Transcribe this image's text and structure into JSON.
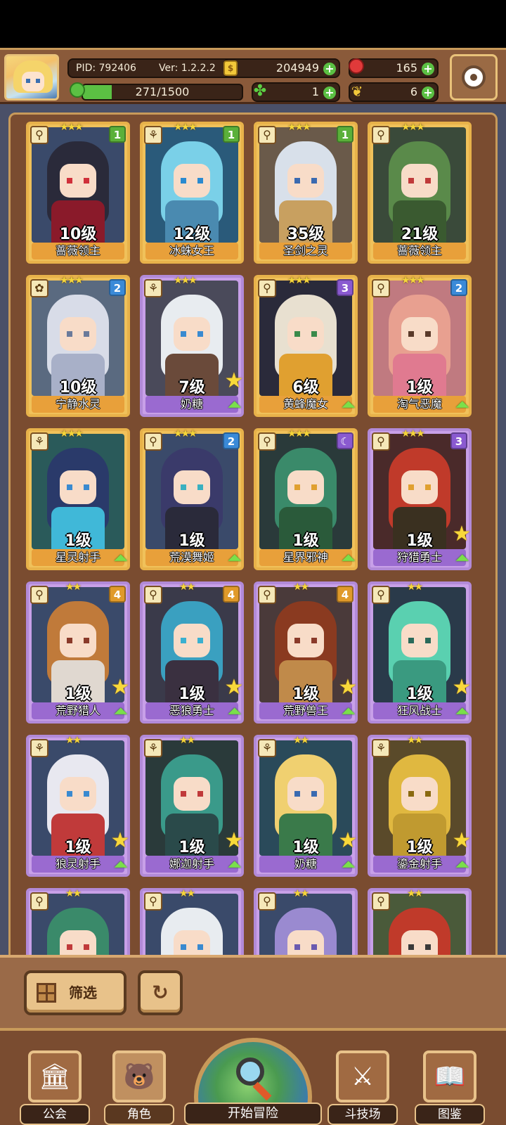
{
  "header": {
    "pid": "PID: 792406",
    "version": "Ver: 1.2.2.2",
    "gold": "204949",
    "gems": "165",
    "energy": "271/1500",
    "energy_fraction": 0.18,
    "clover": "1",
    "tickets": "6",
    "gold_symbol": "$",
    "clover_symbol": "✤",
    "ticket_symbol": "❦"
  },
  "icons": {
    "plus": "+",
    "star3": "★★★",
    "star2": "★★",
    "upgrade": "⏶",
    "bigstar": "★",
    "reset": "↻",
    "guild": "🏛",
    "character": "🐻",
    "arena": "⚔",
    "codex": "📖"
  },
  "cards": [
    {
      "level": "10级",
      "name": "蔷薇领主",
      "badge": "1",
      "badge_color": "green",
      "rarity": "gold",
      "stars": 3,
      "class_icon": "⚲"
    },
    {
      "level": "12级",
      "name": "冰蛛女王",
      "badge": "1",
      "badge_color": "green",
      "rarity": "gold",
      "stars": 3,
      "class_icon": "⚘"
    },
    {
      "level": "35级",
      "name": "圣剑之灵",
      "badge": "1",
      "badge_color": "green",
      "rarity": "gold",
      "stars": 3,
      "class_icon": "⚲"
    },
    {
      "level": "21级",
      "name": "蔷薇领主",
      "badge": "",
      "badge_color": "",
      "rarity": "gold",
      "stars": 3,
      "class_icon": "⚲"
    },
    {
      "level": "10级",
      "name": "宁静水灵",
      "badge": "2",
      "badge_color": "blue",
      "rarity": "gold",
      "stars": 3,
      "class_icon": "✿"
    },
    {
      "level": "7级",
      "name": "奶糖",
      "badge": "",
      "badge_color": "",
      "rarity": "purple",
      "stars": 3,
      "class_icon": "⚘",
      "upgrade": true,
      "star_badge": true
    },
    {
      "level": "6级",
      "name": "黄蜂魔女",
      "badge": "3",
      "badge_color": "purple",
      "rarity": "gold",
      "stars": 3,
      "class_icon": "⚲",
      "upgrade": true
    },
    {
      "level": "1级",
      "name": "淘气恶魔",
      "badge": "2",
      "badge_color": "blue",
      "rarity": "gold",
      "stars": 3,
      "class_icon": "⚲",
      "upgrade": true
    },
    {
      "level": "1级",
      "name": "星灵射手",
      "badge": "",
      "badge_color": "",
      "rarity": "gold",
      "stars": 3,
      "class_icon": "⚘",
      "upgrade": true
    },
    {
      "level": "1级",
      "name": "荒漠舞姬",
      "badge": "2",
      "badge_color": "blue",
      "rarity": "gold",
      "stars": 3,
      "class_icon": "⚲",
      "upgrade": true
    },
    {
      "level": "1级",
      "name": "星界邪神",
      "badge": "☾",
      "badge_color": "purple",
      "rarity": "gold",
      "stars": 3,
      "class_icon": "⚲",
      "upgrade": true
    },
    {
      "level": "1级",
      "name": "狩猎勇士",
      "badge": "3",
      "badge_color": "purple",
      "rarity": "purple",
      "stars": 3,
      "class_icon": "⚲",
      "upgrade": true,
      "star_badge": true
    },
    {
      "level": "1级",
      "name": "荒野猎人",
      "badge": "4",
      "badge_color": "orange",
      "rarity": "purple",
      "stars": 2,
      "class_icon": "⚲",
      "upgrade": true,
      "star_badge": true
    },
    {
      "level": "1级",
      "name": "恶狼勇士",
      "badge": "4",
      "badge_color": "orange",
      "rarity": "purple",
      "stars": 2,
      "class_icon": "⚲",
      "upgrade": true,
      "star_badge": true
    },
    {
      "level": "1级",
      "name": "荒野兽王",
      "badge": "4",
      "badge_color": "orange",
      "rarity": "purple",
      "stars": 2,
      "class_icon": "⚲",
      "upgrade": true,
      "star_badge": true
    },
    {
      "level": "1级",
      "name": "狂风战士",
      "badge": "",
      "badge_color": "",
      "rarity": "purple",
      "stars": 2,
      "class_icon": "⚲",
      "upgrade": true,
      "star_badge": true
    },
    {
      "level": "1级",
      "name": "狼灵射手",
      "badge": "",
      "badge_color": "",
      "rarity": "purple",
      "stars": 2,
      "class_icon": "⚘",
      "upgrade": true,
      "star_badge": true
    },
    {
      "level": "1级",
      "name": "娜迦射手",
      "badge": "",
      "badge_color": "",
      "rarity": "purple",
      "stars": 2,
      "class_icon": "⚘",
      "upgrade": true,
      "star_badge": true
    },
    {
      "level": "1级",
      "name": "奶糖",
      "badge": "",
      "badge_color": "",
      "rarity": "purple",
      "stars": 2,
      "class_icon": "⚘",
      "upgrade": true,
      "star_badge": true
    },
    {
      "level": "1级",
      "name": "鎏金射手",
      "badge": "",
      "badge_color": "",
      "rarity": "purple",
      "stars": 2,
      "class_icon": "⚘",
      "upgrade": true,
      "star_badge": true
    },
    {
      "level": "",
      "name": "",
      "badge": "",
      "badge_color": "",
      "rarity": "purple",
      "stars": 2,
      "class_icon": "⚲"
    },
    {
      "level": "",
      "name": "",
      "badge": "",
      "badge_color": "",
      "rarity": "purple",
      "stars": 2,
      "class_icon": "⚲"
    },
    {
      "level": "",
      "name": "",
      "badge": "",
      "badge_color": "",
      "rarity": "purple",
      "stars": 2,
      "class_icon": "⚲"
    },
    {
      "level": "",
      "name": "",
      "badge": "",
      "badge_color": "",
      "rarity": "purple",
      "stars": 2,
      "class_icon": "⚲"
    }
  ],
  "palette": [
    {
      "hair": "#2a2a3a",
      "body": "#8a1a2a",
      "eye": "#d0303a",
      "bg": "#3a4a6a"
    },
    {
      "hair": "#7ad0e8",
      "body": "#4a8ab0",
      "eye": "#2a8ad0",
      "bg": "#2a5a7a"
    },
    {
      "hair": "#d8e0ea",
      "body": "#c8a060",
      "eye": "#3a6ab0",
      "bg": "#6a5a4a"
    },
    {
      "hair": "#5a8a4a",
      "body": "#3a5a30",
      "eye": "#c03a3a",
      "bg": "#3a4a3a"
    },
    {
      "hair": "#d8dce8",
      "body": "#a8b0c8",
      "eye": "#6a7a9a",
      "bg": "#5a6a80"
    },
    {
      "hair": "#e8ecf0",
      "body": "#6a4a3a",
      "eye": "#3a8ad0",
      "bg": "#4a4a5a"
    },
    {
      "hair": "#e8e0d0",
      "body": "#e0a030",
      "eye": "#3a8a4a",
      "bg": "#2a2a3a"
    },
    {
      "hair": "#e8a090",
      "body": "#e07a90",
      "eye": "#5a3a2a",
      "bg": "#c07a80"
    },
    {
      "hair": "#2a3a6a",
      "body": "#40b8d8",
      "eye": "#3a8ad0",
      "bg": "#2a5a5a"
    },
    {
      "hair": "#3a3a6a",
      "body": "#2a2a3a",
      "eye": "#3ab0c0",
      "bg": "#3a4a6a"
    },
    {
      "hair": "#3a8a6a",
      "body": "#2a5a3a",
      "eye": "#e0a030",
      "bg": "#2a3a3a"
    },
    {
      "hair": "#c03a2a",
      "body": "#3a3020",
      "eye": "#e0a030",
      "bg": "#4a2a2a"
    },
    {
      "hair": "#c07a3a",
      "body": "#e0d8d0",
      "eye": "#8a3a2a",
      "bg": "#3a4a6a"
    },
    {
      "hair": "#3aa0c0",
      "body": "#3a3040",
      "eye": "#3ab0d0",
      "bg": "#3a3a4a"
    },
    {
      "hair": "#8a3a20",
      "body": "#c08a4a",
      "eye": "#8a3a2a",
      "bg": "#4a3a3a"
    },
    {
      "hair": "#5ad0b0",
      "body": "#3a9a80",
      "eye": "#2a6a5a",
      "bg": "#2a3a4a"
    },
    {
      "hair": "#e8e8f0",
      "body": "#c03a3a",
      "eye": "#3a8ad0",
      "bg": "#3a4a6a"
    },
    {
      "hair": "#3a9a8a",
      "body": "#2a4a4a",
      "eye": "#c03a3a",
      "bg": "#2a3a3a"
    },
    {
      "hair": "#f0d070",
      "body": "#3a7a4a",
      "eye": "#3a6ab0",
      "bg": "#2a4a5a"
    },
    {
      "hair": "#e0b840",
      "body": "#c09a30",
      "eye": "#8a6a10",
      "bg": "#5a4a2a"
    },
    {
      "hair": "#3a8a6a",
      "body": "#c03a3a",
      "eye": "#c03a3a",
      "bg": "#3a4a6a"
    },
    {
      "hair": "#e8ecf0",
      "body": "#a0a0b0",
      "eye": "#3a8ad0",
      "bg": "#3a4a6a"
    },
    {
      "hair": "#9a8ad0",
      "body": "#6a5a9a",
      "eye": "#6a5ab0",
      "bg": "#3a4a6a"
    },
    {
      "hair": "#c03a2a",
      "body": "#3a8a4a",
      "eye": "#3a3a3a",
      "bg": "#4a5a3a"
    }
  ],
  "filter": {
    "label": "筛选"
  },
  "nav": {
    "guild": "公会",
    "character": "角色",
    "adventure": "开始冒险",
    "arena": "斗技场",
    "codex": "图鉴"
  }
}
